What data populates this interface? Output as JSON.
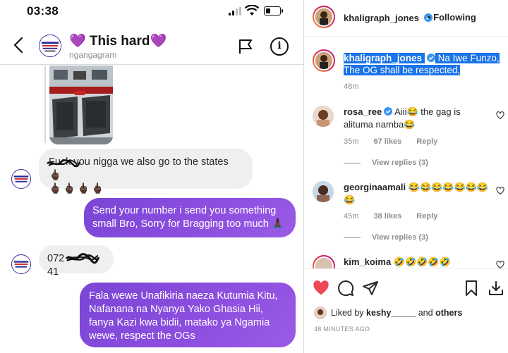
{
  "dm": {
    "status_time": "03:38",
    "title": "💜 This hard💜",
    "subtitle": "ngangagram",
    "messages": [
      {
        "sender": "other",
        "text_line1": "Fuck you nigga we also go to the states 🖕🏿",
        "text_line2": "🖕🏿🖕🏿🖕🏿🖕🏿"
      },
      {
        "sender": "me",
        "text": "Send your number i send you something small Bro, Sorry for Bragging too much 🙏🏿"
      },
      {
        "sender": "other",
        "text_prefix": "072",
        "text_suffix": "41"
      },
      {
        "sender": "me",
        "text": "Fala wewe Unafikiria naeza Kutumia Kitu, Nafanana na Nyanya Yako Ghasia Hii, fanya Kazi kwa bidii, matako ya Ngamia wewe, respect the OGs"
      }
    ]
  },
  "post": {
    "author": "khaligraph_jones",
    "following_label": "• Following",
    "caption_user": "khaligraph_jones",
    "caption_text": "Na Iwe Funzo, The OG shall be respected,",
    "caption_time": "48m",
    "comments": [
      {
        "user": "rosa_ree",
        "verified": true,
        "text": "Aiii😂 the gag is alituma namba😂",
        "time": "35m",
        "likes": "67 likes",
        "reply": "Reply",
        "view_replies": "View replies (3)"
      },
      {
        "user": "georginaamali",
        "verified": false,
        "text": "😂😂😂😂😂😂😂😂",
        "time": "45m",
        "likes": "38 likes",
        "reply": "Reply",
        "view_replies": "View replies (3)"
      },
      {
        "user": "kim_koima",
        "verified": false,
        "text": "🤣🤣🤣🤣🤣"
      }
    ],
    "liked_by_prefix": "Liked by",
    "liked_by_user": "keshy_____",
    "liked_by_and": "and",
    "liked_by_others": "others",
    "post_time": "48 MINUTES AGO"
  },
  "colors": {
    "outgoing_bubble": "#8e4fe0",
    "incoming_bubble": "#efefef",
    "like_red": "#ed4956",
    "selection_blue": "#1a73e8",
    "verified_blue": "#3897f0"
  }
}
